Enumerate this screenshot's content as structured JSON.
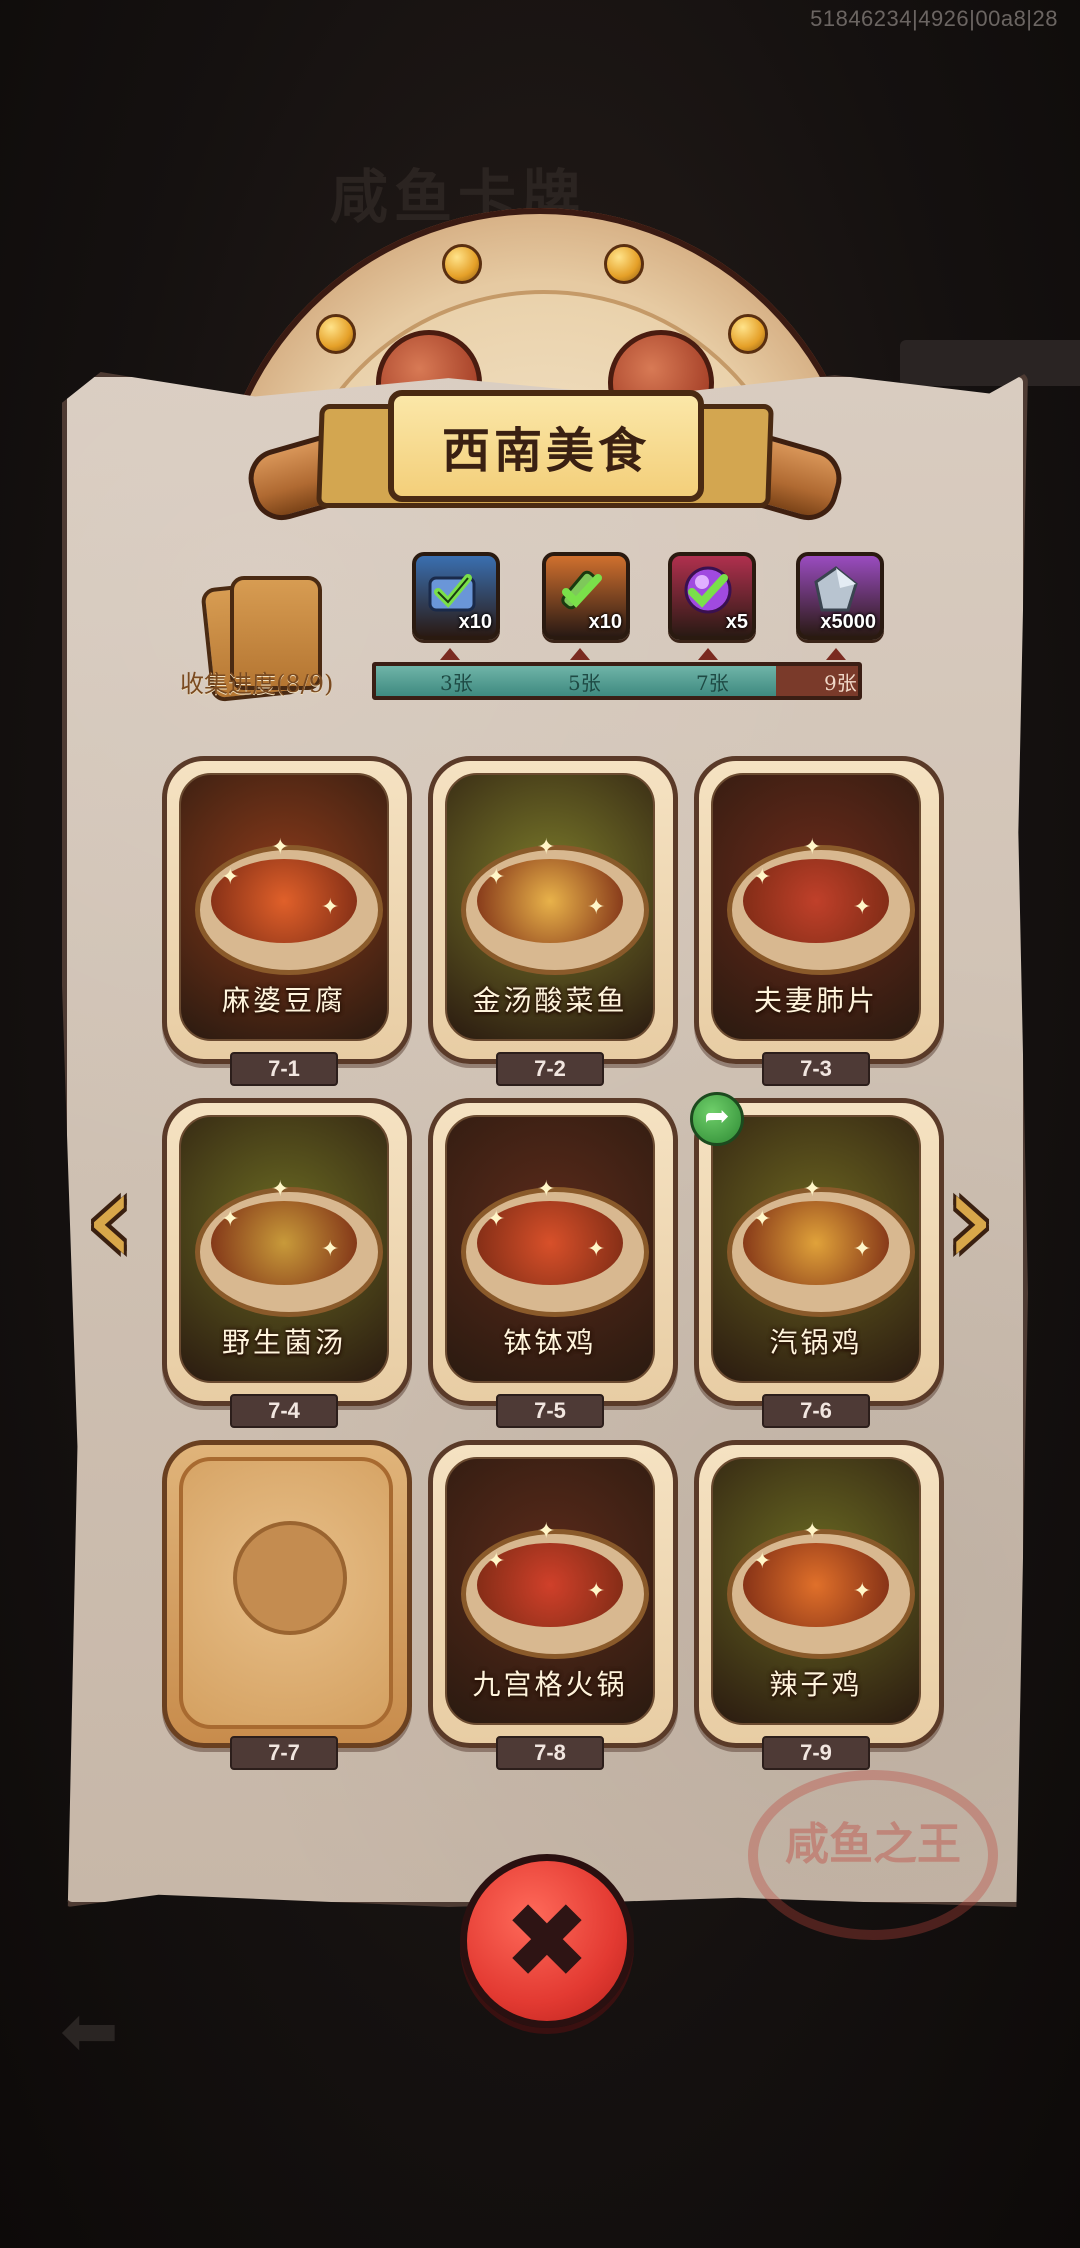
{
  "debug": {
    "build_id": "51846234|4926|00a8|28"
  },
  "background": {
    "blurred_title": "咸鱼卡牌"
  },
  "header": {
    "title": "西南美食"
  },
  "collection": {
    "label": "收集进度(8/9)",
    "collected": 8,
    "total": 9,
    "progress_fraction": 0.83
  },
  "rewards": [
    {
      "icon": "blue-chest-check-icon",
      "qty": "x10",
      "color": "#3a6fb0"
    },
    {
      "icon": "orange-key-check-icon",
      "qty": "x10",
      "color": "#d0702e"
    },
    {
      "icon": "purple-orb-check-icon",
      "qty": "x5",
      "color": "#b0304e"
    },
    {
      "icon": "crystal-stone-icon",
      "qty": "x5000",
      "color": "#9a4cc0"
    }
  ],
  "milestones": [
    {
      "label": "3张"
    },
    {
      "label": "5张"
    },
    {
      "label": "7张"
    },
    {
      "label": "9张"
    }
  ],
  "recipes": [
    {
      "id": "7-1",
      "name": "麻婆豆腐",
      "locked": false,
      "bg": "#8a3a1a",
      "food": "#e0602a"
    },
    {
      "id": "7-2",
      "name": "金汤酸菜鱼",
      "locked": false,
      "bg": "#7a7a2a",
      "food": "#e8b24a"
    },
    {
      "id": "7-3",
      "name": "夫妻肺片",
      "locked": false,
      "bg": "#6a2a1a",
      "food": "#c0402a"
    },
    {
      "id": "7-4",
      "name": "野生菌汤",
      "locked": false,
      "bg": "#6a6a22",
      "food": "#c89a3a"
    },
    {
      "id": "7-5",
      "name": "钵钵鸡",
      "locked": false,
      "bg": "#5a2a1a",
      "food": "#d8502a"
    },
    {
      "id": "7-6",
      "name": "汽锅鸡",
      "locked": false,
      "bg": "#6a6420",
      "food": "#e0a23a"
    },
    {
      "id": "7-7",
      "name": "",
      "locked": true,
      "bg": "#d4a060",
      "food": "#c48c50"
    },
    {
      "id": "7-8",
      "name": "九宫格火锅",
      "locked": false,
      "bg": "#5a2a1a",
      "food": "#d0402a"
    },
    {
      "id": "7-9",
      "name": "辣子鸡",
      "locked": false,
      "bg": "#6a6a22",
      "food": "#e0702a"
    }
  ],
  "navigation": {
    "prev_icon": "chevron-left-icon",
    "next_icon": "chevron-right-icon"
  },
  "share": {
    "icon": "share-arrow-icon"
  },
  "close": {
    "icon": "close-x-icon",
    "glyph": "✖"
  },
  "stamp": {
    "text": "咸鱼之王"
  }
}
